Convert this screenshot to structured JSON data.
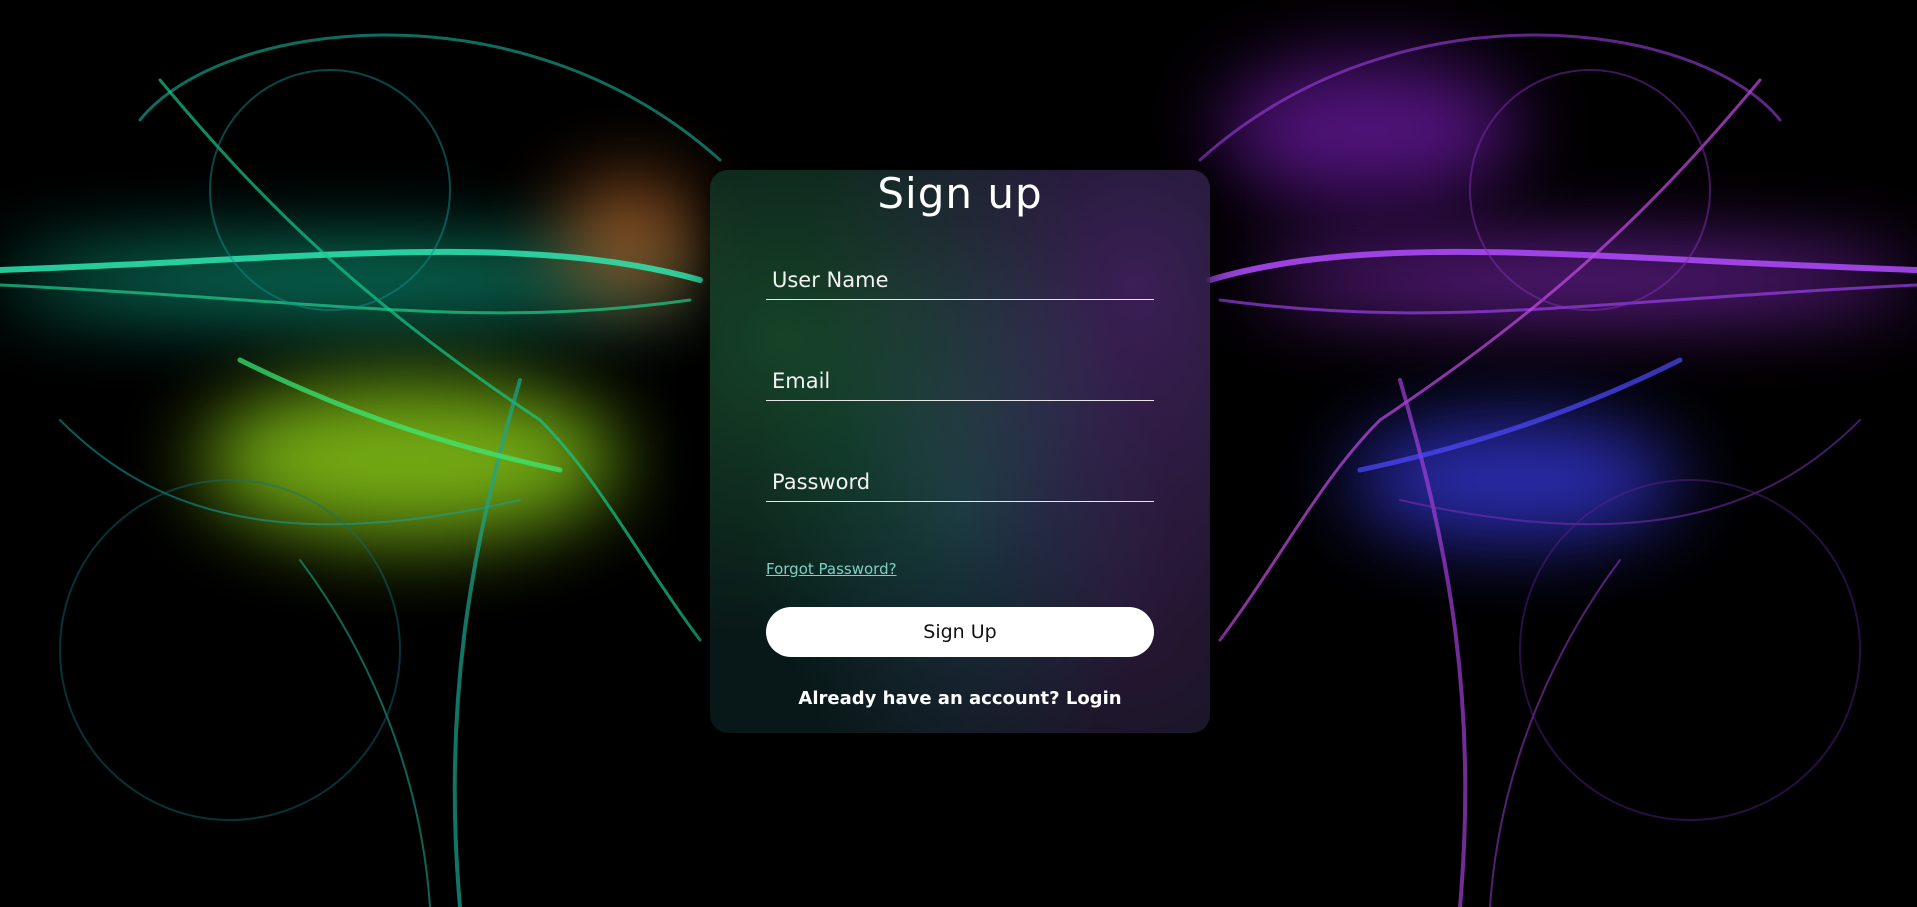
{
  "colors": {
    "page_background": "#000000",
    "button_background": "#ffffff",
    "link_color": "#7fd0c4",
    "text_color": "#ffffff"
  },
  "form": {
    "title": "Sign up",
    "username_placeholder": "User Name",
    "email_placeholder": "Email",
    "password_placeholder": "Password",
    "forgot_password": "Forgot Password?",
    "submit_label": "Sign Up",
    "already_text": "Already have an account?",
    "login_link": "Login"
  }
}
